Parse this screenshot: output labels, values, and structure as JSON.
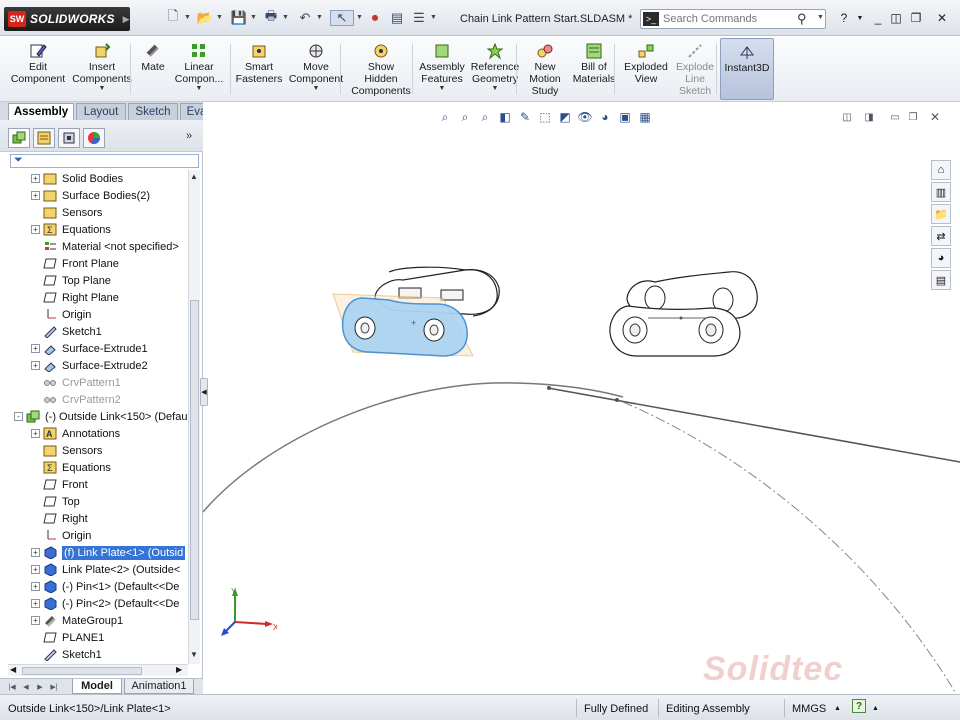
{
  "app": {
    "logo_badge": "SW",
    "logo_text": "SOLIDWORKS"
  },
  "document": {
    "title": "Chain Link Pattern Start.SLDASM *"
  },
  "search": {
    "placeholder": "Search Commands"
  },
  "ribbon": {
    "buttons": [
      {
        "label": "Edit\nComponent",
        "icon": "edit-component-icon",
        "disabled": false
      },
      {
        "label": "Insert\nComponents",
        "icon": "insert-components-icon",
        "disabled": false
      },
      {
        "label": "Mate",
        "icon": "mate-icon",
        "disabled": false
      },
      {
        "label": "Linear\nCompon...",
        "icon": "linear-pattern-icon",
        "disabled": false
      },
      {
        "label": "Smart\nFasteners",
        "icon": "smart-fasteners-icon",
        "disabled": false
      },
      {
        "label": "Move\nComponent",
        "icon": "move-component-icon",
        "disabled": false
      },
      {
        "label": "Show\nHidden\nComponents",
        "icon": "show-hidden-icon",
        "disabled": false
      },
      {
        "label": "Assembly\nFeatures",
        "icon": "assembly-features-icon",
        "disabled": false
      },
      {
        "label": "Reference\nGeometry",
        "icon": "reference-geometry-icon",
        "disabled": false
      },
      {
        "label": "New\nMotion\nStudy",
        "icon": "motion-study-icon",
        "disabled": false
      },
      {
        "label": "Bill of\nMaterials",
        "icon": "bom-icon",
        "disabled": false
      },
      {
        "label": "Exploded\nView",
        "icon": "exploded-view-icon",
        "disabled": false
      },
      {
        "label": "Explode\nLine\nSketch",
        "icon": "explode-line-icon",
        "disabled": true
      },
      {
        "label": "Instant3D",
        "icon": "instant3d-icon",
        "disabled": false,
        "active": true
      }
    ]
  },
  "tabs": [
    "Assembly",
    "Layout",
    "Sketch",
    "Evaluate"
  ],
  "tree": [
    {
      "label": "Solid Bodies",
      "icon": "folder-icon",
      "expand": "+",
      "dim": false
    },
    {
      "label": "Surface Bodies(2)",
      "icon": "folder-icon",
      "expand": "+",
      "dim": false
    },
    {
      "label": "Sensors",
      "icon": "folder-icon",
      "expand": "",
      "dim": false
    },
    {
      "label": "Equations",
      "icon": "equations-icon",
      "expand": "+",
      "dim": false
    },
    {
      "label": "Material <not specified>",
      "icon": "material-icon",
      "expand": "",
      "dim": false
    },
    {
      "label": "Front Plane",
      "icon": "plane-icon",
      "expand": "",
      "dim": false
    },
    {
      "label": "Top Plane",
      "icon": "plane-icon",
      "expand": "",
      "dim": false
    },
    {
      "label": "Right Plane",
      "icon": "plane-icon",
      "expand": "",
      "dim": false
    },
    {
      "label": "Origin",
      "icon": "origin-icon",
      "expand": "",
      "dim": false
    },
    {
      "label": "Sketch1",
      "icon": "sketch-icon",
      "expand": "",
      "dim": false
    },
    {
      "label": "Surface-Extrude1",
      "icon": "extrude-icon",
      "expand": "+",
      "dim": false
    },
    {
      "label": "Surface-Extrude2",
      "icon": "extrude-icon",
      "expand": "+",
      "dim": false
    },
    {
      "label": "CrvPattern1",
      "icon": "pattern-icon",
      "expand": "",
      "dim": true
    },
    {
      "label": "CrvPattern2",
      "icon": "pattern-icon",
      "expand": "",
      "dim": true
    },
    {
      "label": "(-) Outside Link<150> (Defau",
      "icon": "subassembly-icon",
      "expand": "-",
      "dim": false
    },
    {
      "label": "Annotations",
      "icon": "annotations-icon",
      "expand": "+",
      "dim": false
    },
    {
      "label": "Sensors",
      "icon": "folder-icon",
      "expand": "",
      "dim": false
    },
    {
      "label": "Equations",
      "icon": "equations-icon",
      "expand": "",
      "dim": false
    },
    {
      "label": "Front",
      "icon": "plane-icon",
      "expand": "",
      "dim": false
    },
    {
      "label": "Top",
      "icon": "plane-icon",
      "expand": "",
      "dim": false
    },
    {
      "label": "Right",
      "icon": "plane-icon",
      "expand": "",
      "dim": false
    },
    {
      "label": "Origin",
      "icon": "origin-icon",
      "expand": "",
      "dim": false
    },
    {
      "label": "(f) Link Plate<1> (Outsid",
      "icon": "part-icon",
      "expand": "+",
      "dim": false,
      "selected": true
    },
    {
      "label": "Link Plate<2> (Outside<",
      "icon": "part-icon",
      "expand": "+",
      "dim": false
    },
    {
      "label": "(-) Pin<1> (Default<<De",
      "icon": "part-icon",
      "expand": "+",
      "dim": false
    },
    {
      "label": "(-) Pin<2> (Default<<De",
      "icon": "part-icon",
      "expand": "+",
      "dim": false
    },
    {
      "label": "MateGroup1",
      "icon": "mategroup-icon",
      "expand": "+",
      "dim": false
    },
    {
      "label": "PLANE1",
      "icon": "plane-icon",
      "expand": "",
      "dim": false
    },
    {
      "label": "Sketch1",
      "icon": "sketch-icon",
      "expand": "",
      "dim": false
    }
  ],
  "bottom_tabs": [
    "Model",
    "Animation1"
  ],
  "status": {
    "path": "Outside Link<150>/Link Plate<1>",
    "state": "Fully Defined",
    "mode": "Editing Assembly",
    "units": "MMGS"
  },
  "watermark": "Solidtec",
  "colors": {
    "accent": "#3374d6",
    "selection": "#5fa8e8",
    "logo_red": "#d8251c"
  }
}
